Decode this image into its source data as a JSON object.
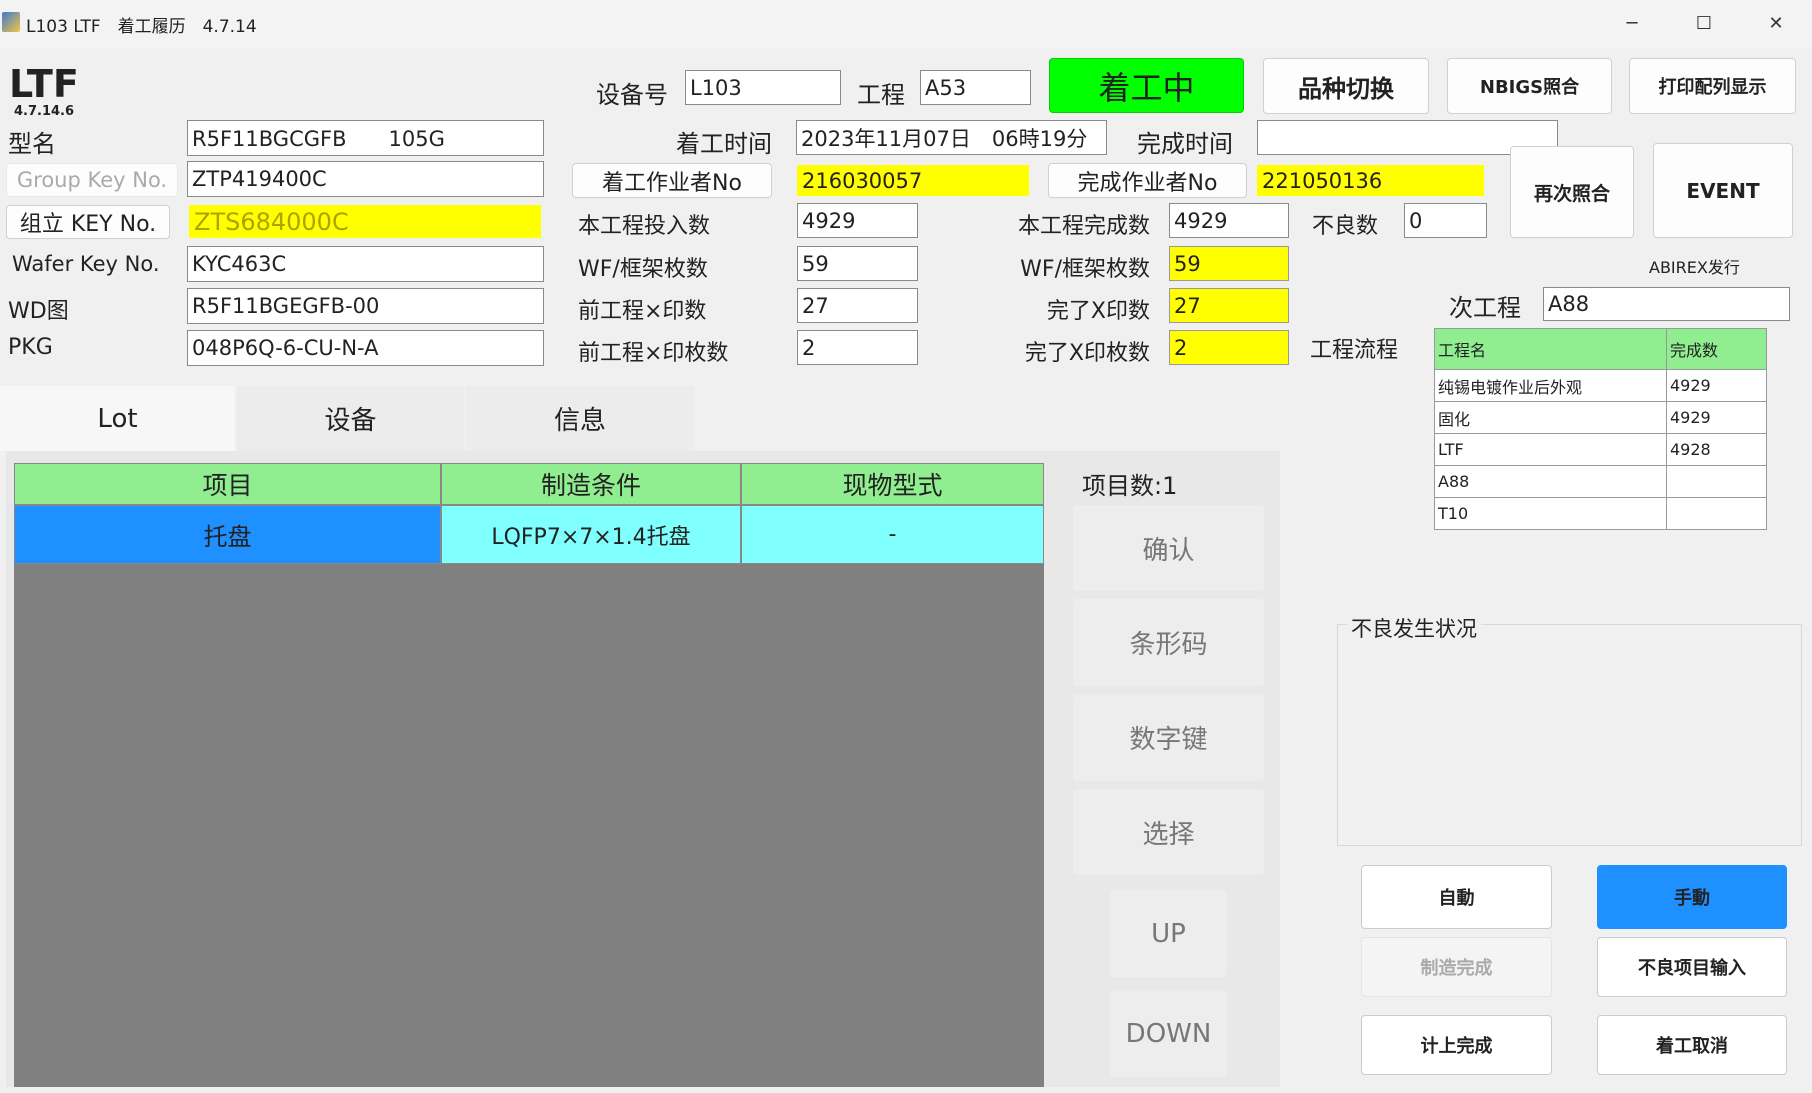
{
  "window": {
    "title": "L103 LTF　着工履历　4.7.14",
    "minimize": "─",
    "maximize": "☐",
    "close": "✕"
  },
  "logo": {
    "name": "LTF",
    "version": "4.7.14.6"
  },
  "left": {
    "model_label": "型名",
    "model": "R5F11BGCGFB　　105G",
    "group_key_label": "Group Key No.",
    "group_key": "ZTP419400C",
    "assembly_key_label": "组立 KEY No.",
    "assembly_key": "ZTS684000C",
    "wafer_key_label": "Wafer Key No.",
    "wafer_key": "KYC463C",
    "wd_label": "WD图",
    "wd": "R5F11BGEGFB-00",
    "pkg_label": "PKG",
    "pkg": "048P6Q-6-CU-N-A"
  },
  "header": {
    "device_label": "设备号",
    "device": "L103",
    "process_label": "工程",
    "process": "A53",
    "status": "着工中",
    "switch_btn": "品种切换",
    "nbigs_btn": "NBIGS照合",
    "print_btn": "打印配列显示"
  },
  "times": {
    "start_label": "着工时间",
    "start": "2023年11月07日　06時19分",
    "finish_label": "完成时间",
    "finish": ""
  },
  "workers": {
    "start_btn": "着工作业者No",
    "start": "216030057",
    "finish_btn": "完成作业者No",
    "finish": "221050136"
  },
  "actions": {
    "recheck": "再次照合",
    "event": "EVENT",
    "abirex": "ABIREX发行"
  },
  "counts": {
    "input_label": "本工程投入数",
    "input": "4929",
    "done_label": "本工程完成数",
    "done": "4929",
    "defect_label": "不良数",
    "defect": "0",
    "wf_label": "WF/框架枚数",
    "wf": "59",
    "wf_done_label": "WF/框架枚数",
    "wf_done": "59",
    "prev_x_label": "前工程×印数",
    "prev_x": "27",
    "done_x_label": "完了X印数",
    "done_x": "27",
    "prev_xs_label": "前工程×印枚数",
    "prev_xs": "2",
    "done_xs_label": "完了X印枚数",
    "done_xs": "2"
  },
  "next": {
    "label": "次工程",
    "value": "A88",
    "flow_label": "工程流程",
    "columns": [
      "工程名",
      "完成数"
    ],
    "rows": [
      [
        "纯锡电镀作业后外观",
        "4929"
      ],
      [
        "固化",
        "4929"
      ],
      [
        "LTF",
        "4928"
      ],
      [
        "A88",
        ""
      ],
      [
        "T10",
        ""
      ]
    ]
  },
  "tabs": [
    "Lot",
    "设备",
    "信息"
  ],
  "grid": {
    "columns": [
      "项目",
      "制造条件",
      "现物型式"
    ],
    "rows": [
      [
        "托盘",
        "LQFP7×7×1.4托盘",
        "-"
      ]
    ],
    "count": "项目数:1"
  },
  "side_buttons": {
    "confirm": "确认",
    "barcode": "条形码",
    "numpad": "数字键",
    "select": "选择",
    "up": "UP",
    "down": "DOWN"
  },
  "defect_group": "不良发生状况",
  "bottom": {
    "auto": "自動",
    "manual": "手動",
    "mfg_done": "制造完成",
    "defect_input": "不良项目输入",
    "count_done": "计上完成",
    "cancel": "着工取消"
  },
  "colors": {
    "status_green": "#00ff00",
    "highlight_yellow": "#ffff00",
    "selected_blue": "#1e90ff",
    "header_green": "#90ee90",
    "cell_cyan": "#80ffff"
  }
}
